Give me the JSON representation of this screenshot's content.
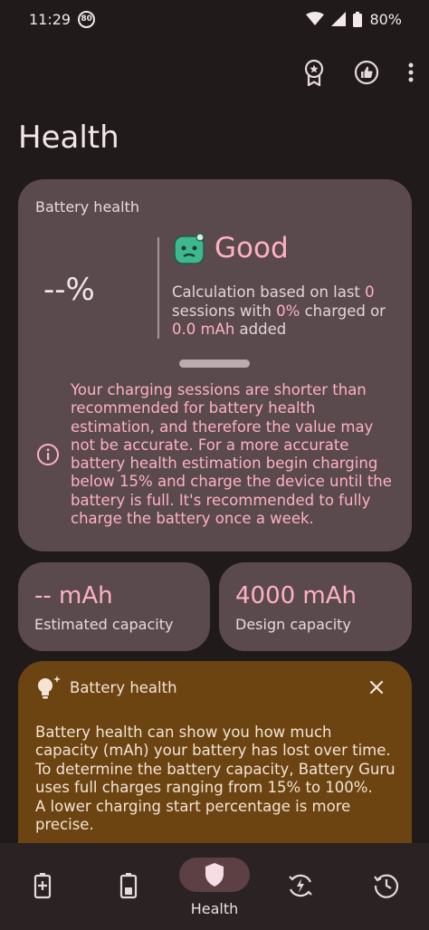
{
  "status_bar": {
    "time": "11:29",
    "badge": "80",
    "battery_percent": "80%"
  },
  "header": {
    "title": "Health",
    "icons": [
      "award-icon",
      "thumbs-up-icon",
      "more-vert-icon"
    ]
  },
  "health_card": {
    "label": "Battery health",
    "percent": "--%",
    "status": "Good",
    "calc_prefix": "Calculation based on last ",
    "sessions": "0",
    "calc_mid": " sessions with ",
    "charged": "0%",
    "calc_mid2": " charged or ",
    "added": "0.0 mAh",
    "calc_suffix": " added",
    "warning": "Your charging sessions are shorter than recommended for battery health estimation, and therefore the value may not be accurate. For a more accurate battery health estimation begin charging below 15% and charge the device until the battery is full. It's recommended to fully charge the battery once a week."
  },
  "capacity": {
    "estimated_value": "-- mAh",
    "estimated_label": "Estimated capacity",
    "design_value": "4000 mAh",
    "design_label": "Design capacity"
  },
  "tip_card": {
    "title": "Battery health",
    "text": "Battery health can show you how much capacity (mAh) your battery has lost over time. To determine the battery capacity, Battery Guru uses full charges ranging from 15% to 100%.\nA lower charging start percentage is more precise."
  },
  "bottom_nav": {
    "active_label": "Health"
  },
  "colors": {
    "accent_pink": "#ffb1c4",
    "card_bg": "#5a4a4d",
    "tip_bg": "#6b4411",
    "page_bg": "#201a1b"
  }
}
